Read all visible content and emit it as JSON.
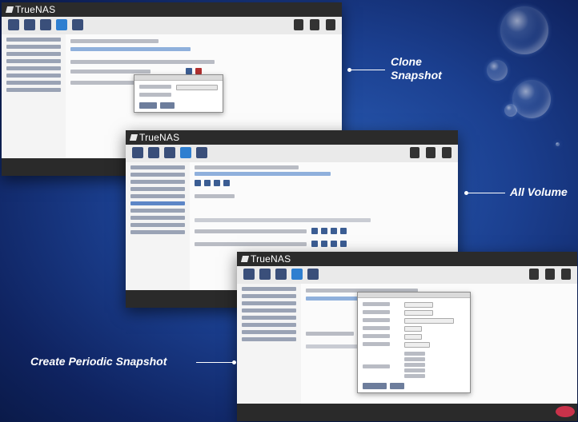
{
  "app_name": "TrueNAS",
  "callouts": {
    "clone": "Clone\nSnapshot",
    "all_volume": "All Volume",
    "periodic": "Create Periodic Snapshot"
  },
  "colors": {
    "accent": "#2f7fd0",
    "background": "#1b3f8f",
    "chrome_dark": "#2b2b2b"
  }
}
